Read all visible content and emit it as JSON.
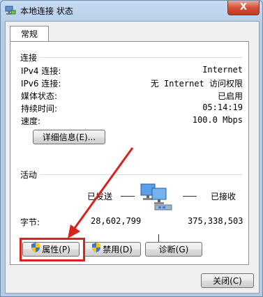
{
  "window": {
    "title": "本地连接 状态",
    "close_label": "X"
  },
  "tabs": [
    {
      "label": "常规"
    }
  ],
  "connection": {
    "heading": "连接",
    "rows": [
      {
        "label": "IPv4 连接:",
        "value": "Internet"
      },
      {
        "label": "IPv6 连接:",
        "value": "无 Internet 访问权限"
      },
      {
        "label": "媒体状态:",
        "value": "已启用"
      },
      {
        "label": "持续时间:",
        "value": "05:14:19"
      },
      {
        "label": "速度:",
        "value": "100.0 Mbps"
      }
    ],
    "details_button": "详细信息(E)..."
  },
  "activity": {
    "heading": "活动",
    "sent_label": "已发送",
    "received_label": "已接收",
    "bytes_label": "字节:",
    "bytes_sent": "28,602,799",
    "bytes_received": "375,338,503"
  },
  "buttons": {
    "properties": "属性(P)",
    "disable": "禁用(D)",
    "diagnose": "诊断(G)",
    "close": "关闭(C)"
  },
  "colors": {
    "highlight_red": "#d9231a",
    "window_frame": "#b9d1ea"
  }
}
